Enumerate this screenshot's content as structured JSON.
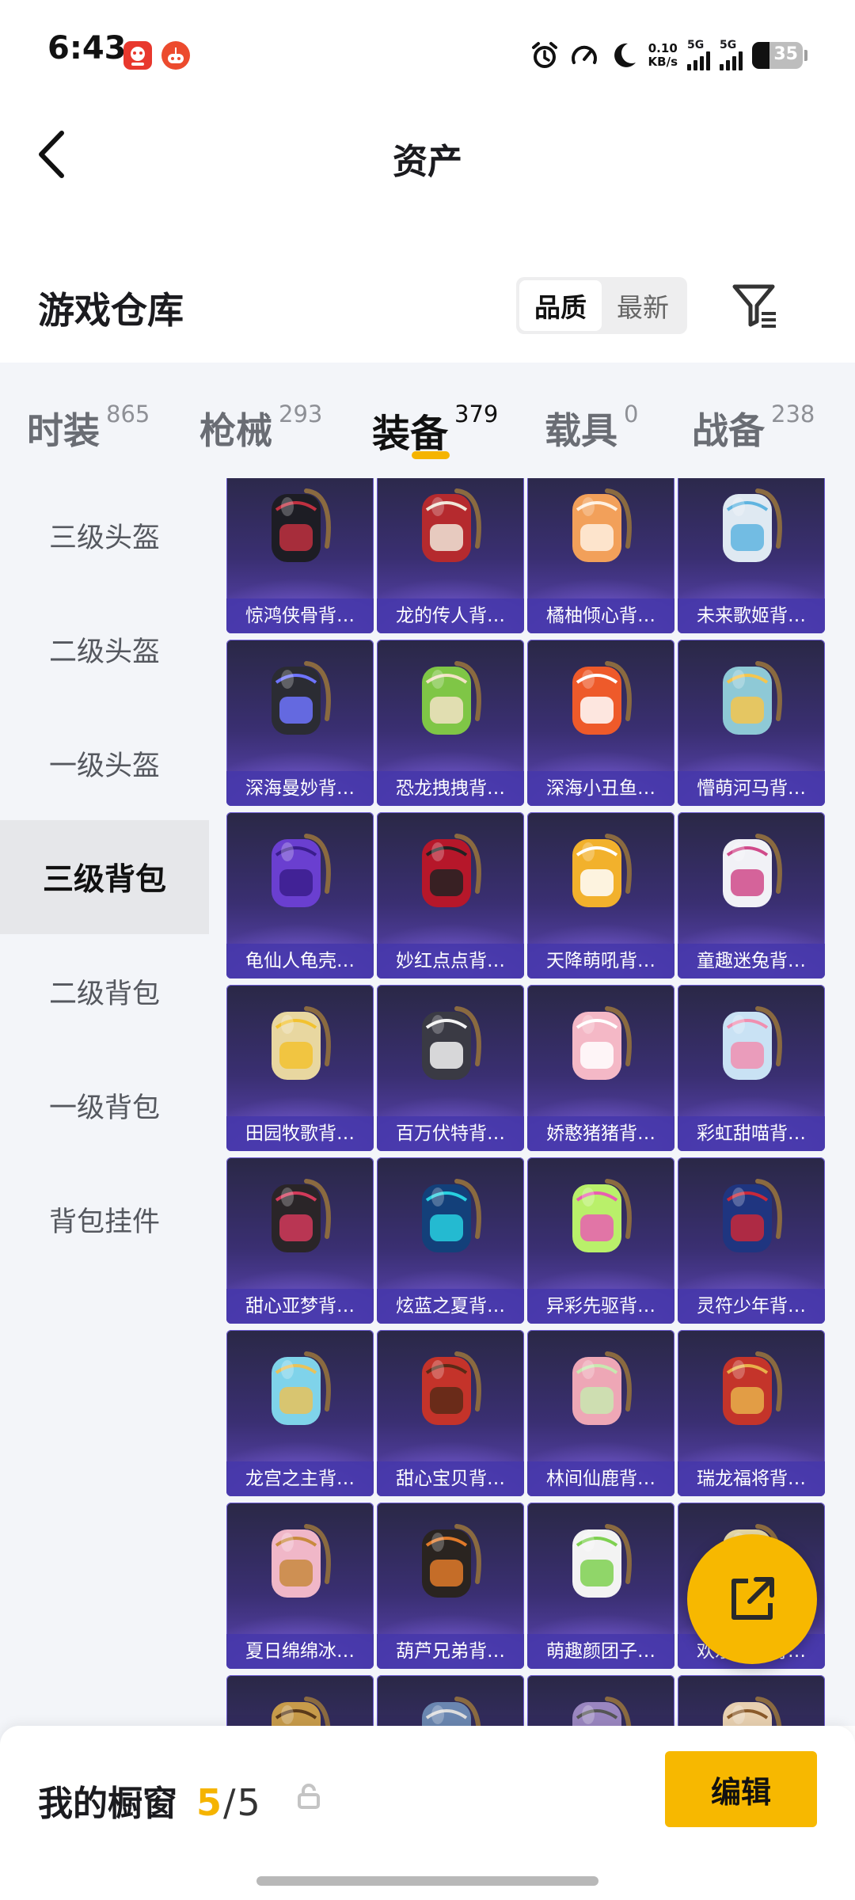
{
  "status_bar": {
    "time": "6:43",
    "net_speed_value": "0.10",
    "net_speed_unit": "KB/s",
    "sim1": "5G",
    "sim2": "5G",
    "battery": "35",
    "battery_level": 0.35,
    "icons": [
      "app-notification-icon",
      "app-notification-icon-2",
      "alarm-icon",
      "speedometer-icon",
      "moon-icon",
      "signal-icon",
      "battery-icon"
    ]
  },
  "header": {
    "title": "资产",
    "back_icon": "chevron-left-icon"
  },
  "section": {
    "title": "游戏仓库",
    "sort_options": [
      "品质",
      "最新"
    ],
    "sort_selected": "品质",
    "filter_icon": "filter-icon"
  },
  "tabs": [
    {
      "label": "时装",
      "count": "865"
    },
    {
      "label": "枪械",
      "count": "293"
    },
    {
      "label": "装备",
      "count": "379",
      "active": true
    },
    {
      "label": "载具",
      "count": "0"
    },
    {
      "label": "战备",
      "count": "238"
    }
  ],
  "sidebar": {
    "items": [
      "三级头盔",
      "二级头盔",
      "一级头盔",
      "三级背包",
      "二级背包",
      "一级背包",
      "背包挂件"
    ],
    "active": "三级背包"
  },
  "grid": {
    "items": [
      {
        "name": "惊鸿侠骨背包",
        "display": "惊鸿侠骨背…",
        "color": "#1d1d24",
        "accent": "#c03040"
      },
      {
        "name": "龙的传人背包",
        "display": "龙的传人背…",
        "color": "#b52a2e",
        "accent": "#f0e6d8"
      },
      {
        "name": "橘柚倾心背包",
        "display": "橘柚倾心背…",
        "color": "#f2a05a",
        "accent": "#fff0e0"
      },
      {
        "name": "未来歌姬背包",
        "display": "未来歌姬背…",
        "color": "#dfe9f2",
        "accent": "#5fb4e0"
      },
      {
        "name": "深海曼妙背包",
        "display": "深海曼妙背…",
        "color": "#2b2c33",
        "accent": "#6e74ff"
      },
      {
        "name": "恐龙拽拽背包",
        "display": "恐龙拽拽背…",
        "color": "#7fc646",
        "accent": "#f2e2c4"
      },
      {
        "name": "深海小丑鱼背包",
        "display": "深海小丑鱼…",
        "color": "#ee5a2a",
        "accent": "#ffffff"
      },
      {
        "name": "懵萌河马背包",
        "display": "懵萌河马背…",
        "color": "#8ec9d6",
        "accent": "#f4c54e"
      },
      {
        "name": "龟仙人龟壳背包",
        "display": "龟仙人龟壳…",
        "color": "#6a3fd0",
        "accent": "#3a1d8c"
      },
      {
        "name": "妙红点点背包",
        "display": "妙红点点背…",
        "color": "#b6172a",
        "accent": "#222222"
      },
      {
        "name": "天降萌吼背包",
        "display": "天降萌吼背…",
        "color": "#f2b12c",
        "accent": "#ffffff"
      },
      {
        "name": "童趣迷兔背包",
        "display": "童趣迷兔背…",
        "color": "#f1f1f6",
        "accent": "#d04a8a"
      },
      {
        "name": "田园牧歌背包",
        "display": "田园牧歌背…",
        "color": "#e8d7a0",
        "accent": "#f2c230"
      },
      {
        "name": "百万伏特背包",
        "display": "百万伏特背…",
        "color": "#3a3a44",
        "accent": "#f3f3f3"
      },
      {
        "name": "娇憨猪猪背包",
        "display": "娇憨猪猪背…",
        "color": "#f4b8c6",
        "accent": "#ffffff"
      },
      {
        "name": "彩虹甜喵背包",
        "display": "彩虹甜喵背…",
        "color": "#c9e2f4",
        "accent": "#f08fb0"
      },
      {
        "name": "甜心亚梦背包",
        "display": "甜心亚梦背…",
        "color": "#2a2528",
        "accent": "#d23a5a"
      },
      {
        "name": "炫蓝之夏背包",
        "display": "炫蓝之夏背…",
        "color": "#13407a",
        "accent": "#28d0e0"
      },
      {
        "name": "异彩先驱背包",
        "display": "异彩先驱背…",
        "color": "#b9f06a",
        "accent": "#e85fb0"
      },
      {
        "name": "灵符少年背包",
        "display": "灵符少年背…",
        "color": "#1f3580",
        "accent": "#c8283a"
      },
      {
        "name": "龙宫之主背包",
        "display": "龙宫之主背…",
        "color": "#7fd3ea",
        "accent": "#e8c25a"
      },
      {
        "name": "甜心宝贝背包",
        "display": "甜心宝贝背…",
        "color": "#c4332a",
        "accent": "#5a2a16"
      },
      {
        "name": "林间仙鹿背包",
        "display": "林间仙鹿背…",
        "color": "#eea7b6",
        "accent": "#c8e8b0"
      },
      {
        "name": "瑞龙福将背包",
        "display": "瑞龙福将背…",
        "color": "#c4342a",
        "accent": "#e8b04a"
      },
      {
        "name": "夏日绵绵冰背包",
        "display": "夏日绵绵冰…",
        "color": "#f0b7c8",
        "accent": "#c88a3e"
      },
      {
        "name": "葫芦兄弟背包",
        "display": "葫芦兄弟背…",
        "color": "#2a2420",
        "accent": "#e07a2a"
      },
      {
        "name": "萌趣颜团子背包",
        "display": "萌趣颜团子…",
        "color": "#f3f3f3",
        "accent": "#7ed050"
      },
      {
        "name": "欢乐麻酱背包",
        "display": "欢乐麻酱背…",
        "color": "#e6d9a8",
        "accent": "#2aa070"
      },
      {
        "name": "",
        "display": "",
        "color": "#c79b4a",
        "accent": "#5a3a1a"
      },
      {
        "name": "",
        "display": "",
        "color": "#6a86b0",
        "accent": "#dddddd"
      },
      {
        "name": "",
        "display": "",
        "color": "#9a86c0",
        "accent": "#555555"
      },
      {
        "name": "",
        "display": "",
        "color": "#e8d0b0",
        "accent": "#8a5a2a"
      }
    ]
  },
  "fab": {
    "icon": "share-icon"
  },
  "bottom_bar": {
    "showcase_label": "我的橱窗",
    "showcase_current": "5",
    "showcase_separator": "/",
    "showcase_total": "5",
    "lock_icon": "lock-icon",
    "edit_label": "编辑"
  },
  "colors": {
    "accent": "#f7b800",
    "card_gradient_top": "#2a2846",
    "card_gradient_bottom": "#5d46b8",
    "panel_bg": "#f3f5f9"
  }
}
